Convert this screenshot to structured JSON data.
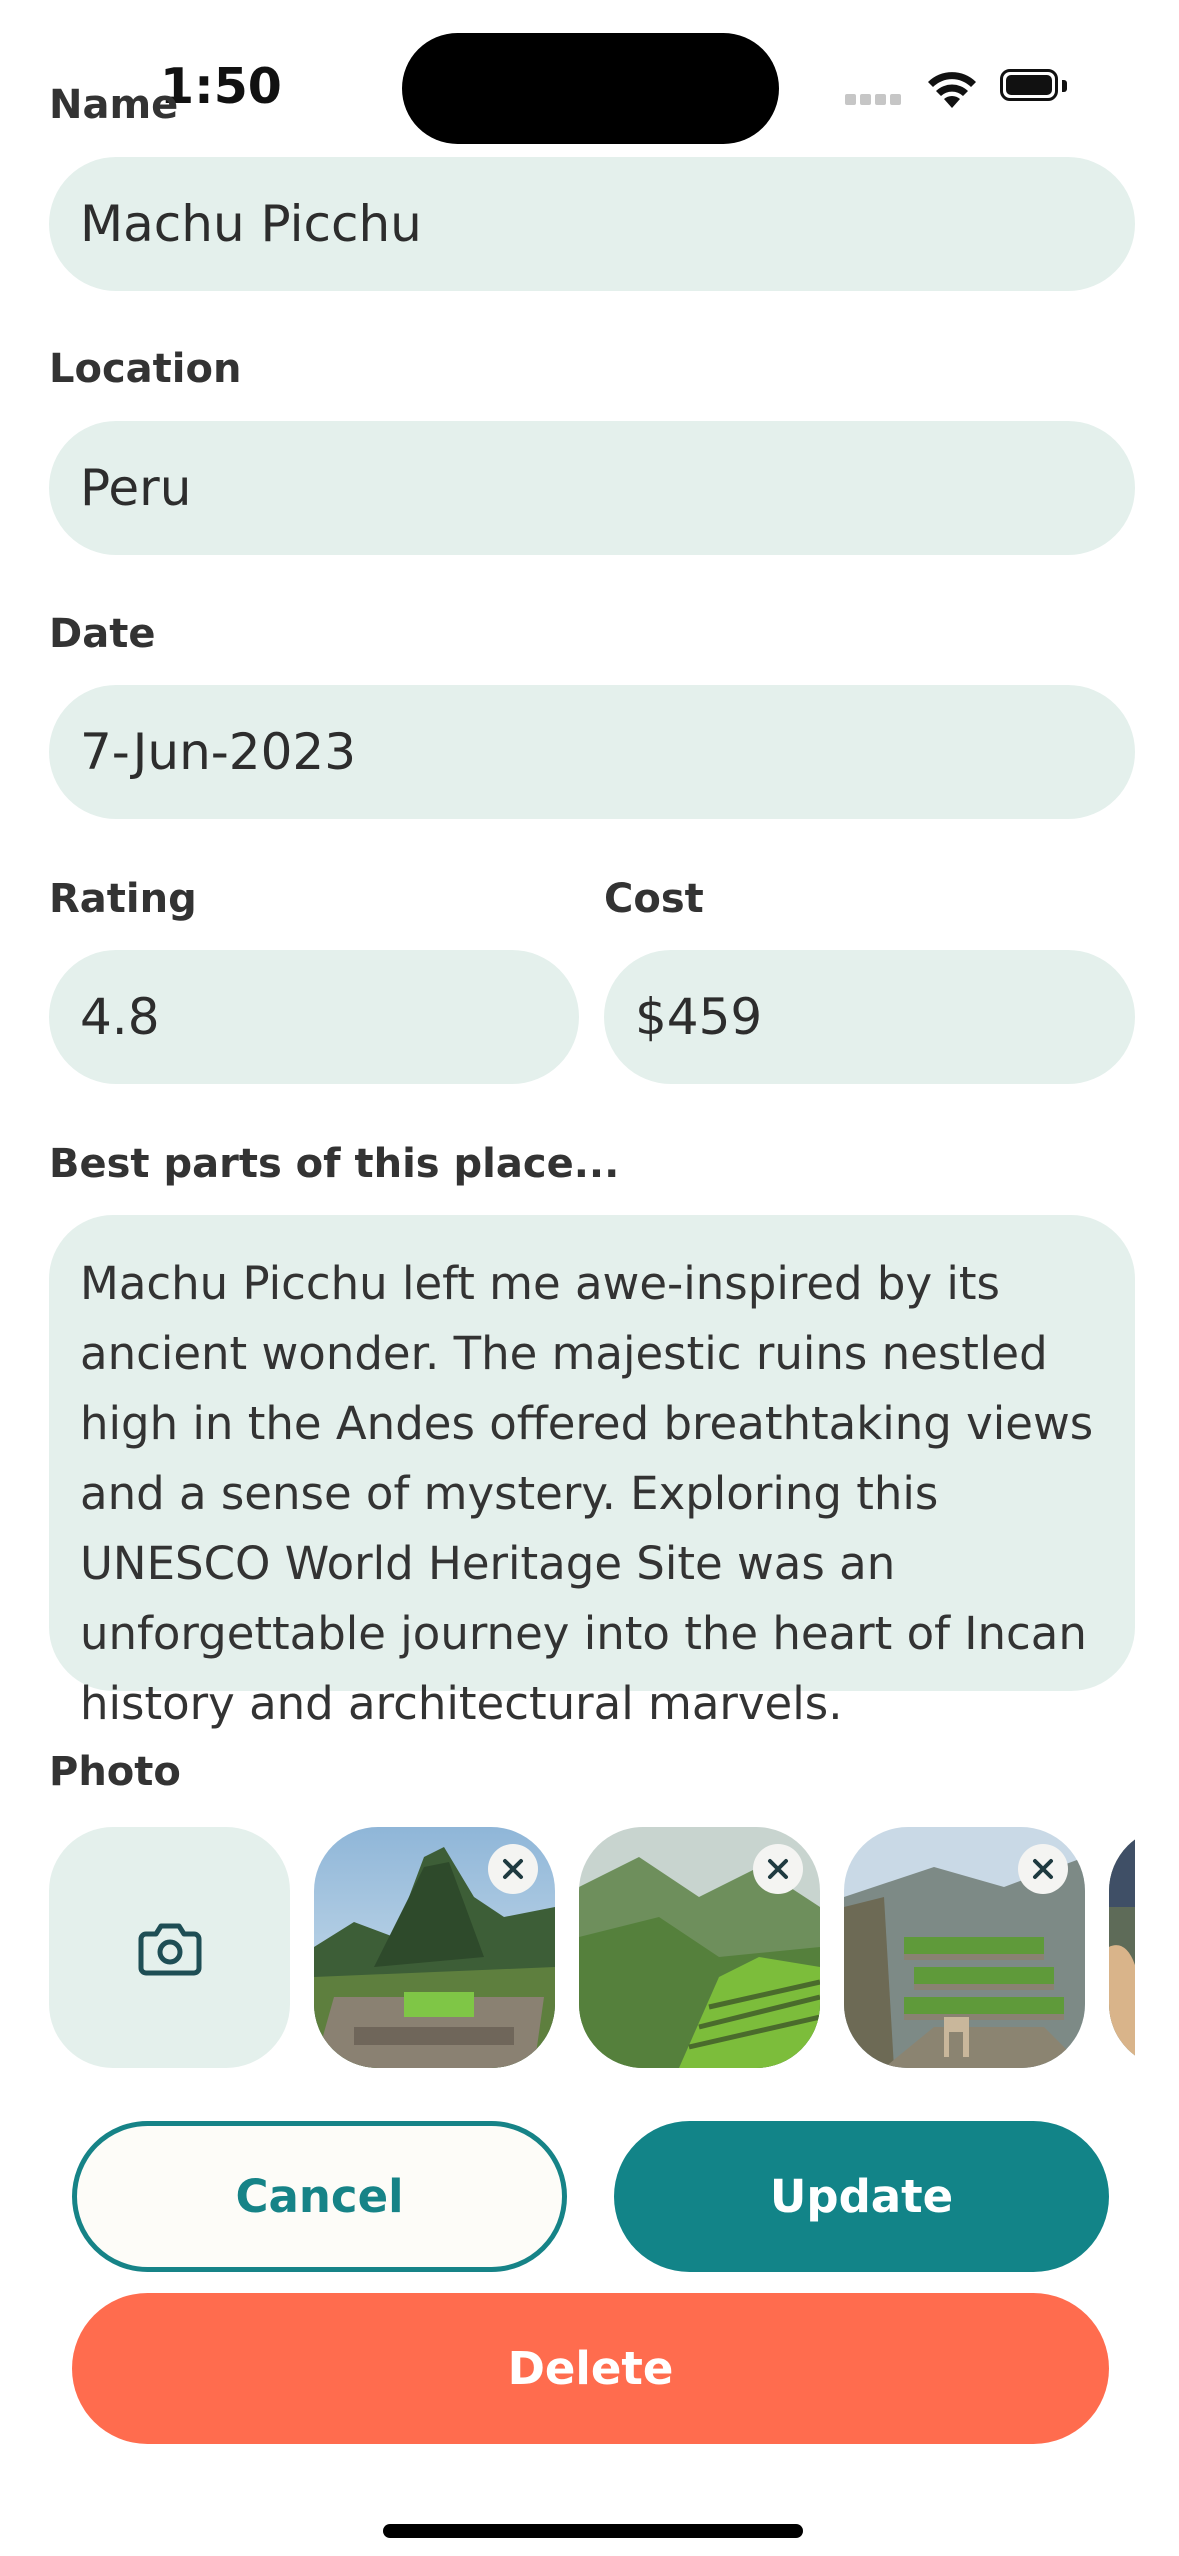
{
  "status_bar": {
    "time": "1:50"
  },
  "form": {
    "name": {
      "label": "Name",
      "value": "Machu Picchu"
    },
    "location": {
      "label": "Location",
      "value": "Peru"
    },
    "date": {
      "label": "Date",
      "value": "7-Jun-2023"
    },
    "rating": {
      "label": "Rating",
      "value": "4.8"
    },
    "cost": {
      "label": "Cost",
      "value": "$459"
    },
    "best_parts": {
      "label": "Best parts of this place...",
      "value": "Machu Picchu left me awe-inspired by its ancient wonder. The majestic ruins nestled high in the Andes offered breathtaking views and a sense of mystery. Exploring this UNESCO World Heritage Site was an unforgettable journey into the heart of Incan history and architectural marvels."
    },
    "photo": {
      "label": "Photo",
      "add_icon": "camera-icon",
      "remove_icon": "close-icon",
      "items": [
        "machu-picchu-citadel",
        "terraced-hillside",
        "terraces-with-llamas",
        "llama"
      ]
    }
  },
  "actions": {
    "cancel_label": "Cancel",
    "update_label": "Update",
    "delete_label": "Delete"
  },
  "colors": {
    "field_bg": "#e4f0ec",
    "teal": "#128488",
    "delete": "#ff6c4e"
  }
}
